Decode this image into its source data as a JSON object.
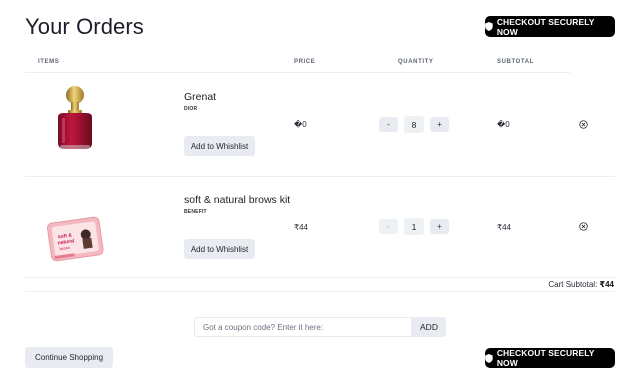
{
  "page": {
    "title": "Your Orders"
  },
  "checkout": {
    "top_label": "CHECKOUT SECURELY NOW",
    "bottom_label": "CHECKOUT SECURELY NOW"
  },
  "table": {
    "headers": {
      "items": "ITEMS",
      "price": "PRICE",
      "quantity": "QUANTITY",
      "subtotal": "SUBTOTAL"
    }
  },
  "items": [
    {
      "name": "Grenat",
      "brand": "DIOR",
      "wishlist_label": "Add to Whishlist",
      "price": "�0",
      "quantity": "8",
      "minus": "-",
      "plus": "+",
      "subtotal": "�0"
    },
    {
      "name": "soft & natural brows kit",
      "brand": "BENEFIT",
      "wishlist_label": "Add to Whishlist",
      "price": "₹44",
      "quantity": "1",
      "minus": "-",
      "plus": "+",
      "subtotal": "₹44"
    }
  ],
  "cart": {
    "subtotal_label": "Cart Subtotal:",
    "subtotal_value": "₹44"
  },
  "coupon": {
    "placeholder": "Got a coupon code? Enter it here:",
    "button": "ADD"
  },
  "continue_label": "Continue Shopping"
}
